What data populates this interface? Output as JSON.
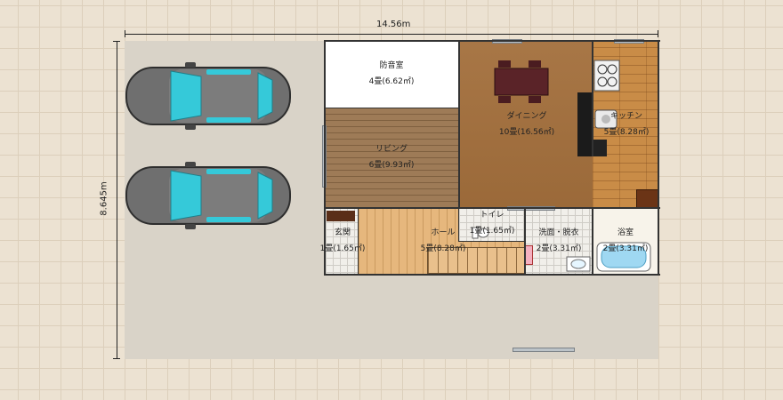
{
  "dimensions": {
    "width_label": "14.56m",
    "height_label": "8.645m"
  },
  "rooms": {
    "soundproof": {
      "name": "防音室",
      "size": "4畳(6.62㎡)"
    },
    "living": {
      "name": "リビング",
      "size": "6畳(9.93㎡)"
    },
    "dining": {
      "name": "ダイニング",
      "size": "10畳(16.56㎡)"
    },
    "kitchen": {
      "name": "キッチン",
      "size": "5畳(8.28㎡)"
    },
    "entrance": {
      "name": "玄関",
      "size": "1畳(1.65㎡)"
    },
    "hall": {
      "name": "ホール",
      "size": "5畳(8.28㎡)"
    },
    "toilet": {
      "name": "トイレ",
      "size": "1畳(1.65㎡)"
    },
    "washroom": {
      "name": "洗面・脱衣",
      "size": "2畳(3.31㎡)"
    },
    "bath": {
      "name": "浴室",
      "size": "2畳(3.31㎡)"
    }
  },
  "colors": {
    "car_body": "#6f6f6f",
    "car_glass": "#35c9d9",
    "wall": "#333333"
  },
  "icons": [
    "car-icon",
    "dining-table-icon",
    "stove-icon",
    "sink-icon",
    "bathtub-icon",
    "toilet-icon",
    "washbasin-icon",
    "stairs-icon"
  ]
}
